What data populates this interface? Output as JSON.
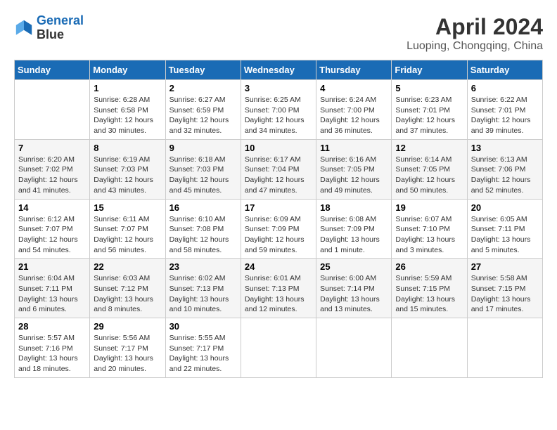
{
  "header": {
    "logo_line1": "General",
    "logo_line2": "Blue",
    "title": "April 2024",
    "subtitle": "Luoping, Chongqing, China"
  },
  "days_of_week": [
    "Sunday",
    "Monday",
    "Tuesday",
    "Wednesday",
    "Thursday",
    "Friday",
    "Saturday"
  ],
  "weeks": [
    [
      {
        "day": "",
        "sunrise": "",
        "sunset": "",
        "daylight": ""
      },
      {
        "day": "1",
        "sunrise": "Sunrise: 6:28 AM",
        "sunset": "Sunset: 6:58 PM",
        "daylight": "Daylight: 12 hours and 30 minutes."
      },
      {
        "day": "2",
        "sunrise": "Sunrise: 6:27 AM",
        "sunset": "Sunset: 6:59 PM",
        "daylight": "Daylight: 12 hours and 32 minutes."
      },
      {
        "day": "3",
        "sunrise": "Sunrise: 6:25 AM",
        "sunset": "Sunset: 7:00 PM",
        "daylight": "Daylight: 12 hours and 34 minutes."
      },
      {
        "day": "4",
        "sunrise": "Sunrise: 6:24 AM",
        "sunset": "Sunset: 7:00 PM",
        "daylight": "Daylight: 12 hours and 36 minutes."
      },
      {
        "day": "5",
        "sunrise": "Sunrise: 6:23 AM",
        "sunset": "Sunset: 7:01 PM",
        "daylight": "Daylight: 12 hours and 37 minutes."
      },
      {
        "day": "6",
        "sunrise": "Sunrise: 6:22 AM",
        "sunset": "Sunset: 7:01 PM",
        "daylight": "Daylight: 12 hours and 39 minutes."
      }
    ],
    [
      {
        "day": "7",
        "sunrise": "Sunrise: 6:20 AM",
        "sunset": "Sunset: 7:02 PM",
        "daylight": "Daylight: 12 hours and 41 minutes."
      },
      {
        "day": "8",
        "sunrise": "Sunrise: 6:19 AM",
        "sunset": "Sunset: 7:03 PM",
        "daylight": "Daylight: 12 hours and 43 minutes."
      },
      {
        "day": "9",
        "sunrise": "Sunrise: 6:18 AM",
        "sunset": "Sunset: 7:03 PM",
        "daylight": "Daylight: 12 hours and 45 minutes."
      },
      {
        "day": "10",
        "sunrise": "Sunrise: 6:17 AM",
        "sunset": "Sunset: 7:04 PM",
        "daylight": "Daylight: 12 hours and 47 minutes."
      },
      {
        "day": "11",
        "sunrise": "Sunrise: 6:16 AM",
        "sunset": "Sunset: 7:05 PM",
        "daylight": "Daylight: 12 hours and 49 minutes."
      },
      {
        "day": "12",
        "sunrise": "Sunrise: 6:14 AM",
        "sunset": "Sunset: 7:05 PM",
        "daylight": "Daylight: 12 hours and 50 minutes."
      },
      {
        "day": "13",
        "sunrise": "Sunrise: 6:13 AM",
        "sunset": "Sunset: 7:06 PM",
        "daylight": "Daylight: 12 hours and 52 minutes."
      }
    ],
    [
      {
        "day": "14",
        "sunrise": "Sunrise: 6:12 AM",
        "sunset": "Sunset: 7:07 PM",
        "daylight": "Daylight: 12 hours and 54 minutes."
      },
      {
        "day": "15",
        "sunrise": "Sunrise: 6:11 AM",
        "sunset": "Sunset: 7:07 PM",
        "daylight": "Daylight: 12 hours and 56 minutes."
      },
      {
        "day": "16",
        "sunrise": "Sunrise: 6:10 AM",
        "sunset": "Sunset: 7:08 PM",
        "daylight": "Daylight: 12 hours and 58 minutes."
      },
      {
        "day": "17",
        "sunrise": "Sunrise: 6:09 AM",
        "sunset": "Sunset: 7:09 PM",
        "daylight": "Daylight: 12 hours and 59 minutes."
      },
      {
        "day": "18",
        "sunrise": "Sunrise: 6:08 AM",
        "sunset": "Sunset: 7:09 PM",
        "daylight": "Daylight: 13 hours and 1 minute."
      },
      {
        "day": "19",
        "sunrise": "Sunrise: 6:07 AM",
        "sunset": "Sunset: 7:10 PM",
        "daylight": "Daylight: 13 hours and 3 minutes."
      },
      {
        "day": "20",
        "sunrise": "Sunrise: 6:05 AM",
        "sunset": "Sunset: 7:11 PM",
        "daylight": "Daylight: 13 hours and 5 minutes."
      }
    ],
    [
      {
        "day": "21",
        "sunrise": "Sunrise: 6:04 AM",
        "sunset": "Sunset: 7:11 PM",
        "daylight": "Daylight: 13 hours and 6 minutes."
      },
      {
        "day": "22",
        "sunrise": "Sunrise: 6:03 AM",
        "sunset": "Sunset: 7:12 PM",
        "daylight": "Daylight: 13 hours and 8 minutes."
      },
      {
        "day": "23",
        "sunrise": "Sunrise: 6:02 AM",
        "sunset": "Sunset: 7:13 PM",
        "daylight": "Daylight: 13 hours and 10 minutes."
      },
      {
        "day": "24",
        "sunrise": "Sunrise: 6:01 AM",
        "sunset": "Sunset: 7:13 PM",
        "daylight": "Daylight: 13 hours and 12 minutes."
      },
      {
        "day": "25",
        "sunrise": "Sunrise: 6:00 AM",
        "sunset": "Sunset: 7:14 PM",
        "daylight": "Daylight: 13 hours and 13 minutes."
      },
      {
        "day": "26",
        "sunrise": "Sunrise: 5:59 AM",
        "sunset": "Sunset: 7:15 PM",
        "daylight": "Daylight: 13 hours and 15 minutes."
      },
      {
        "day": "27",
        "sunrise": "Sunrise: 5:58 AM",
        "sunset": "Sunset: 7:15 PM",
        "daylight": "Daylight: 13 hours and 17 minutes."
      }
    ],
    [
      {
        "day": "28",
        "sunrise": "Sunrise: 5:57 AM",
        "sunset": "Sunset: 7:16 PM",
        "daylight": "Daylight: 13 hours and 18 minutes."
      },
      {
        "day": "29",
        "sunrise": "Sunrise: 5:56 AM",
        "sunset": "Sunset: 7:17 PM",
        "daylight": "Daylight: 13 hours and 20 minutes."
      },
      {
        "day": "30",
        "sunrise": "Sunrise: 5:55 AM",
        "sunset": "Sunset: 7:17 PM",
        "daylight": "Daylight: 13 hours and 22 minutes."
      },
      {
        "day": "",
        "sunrise": "",
        "sunset": "",
        "daylight": ""
      },
      {
        "day": "",
        "sunrise": "",
        "sunset": "",
        "daylight": ""
      },
      {
        "day": "",
        "sunrise": "",
        "sunset": "",
        "daylight": ""
      },
      {
        "day": "",
        "sunrise": "",
        "sunset": "",
        "daylight": ""
      }
    ]
  ]
}
